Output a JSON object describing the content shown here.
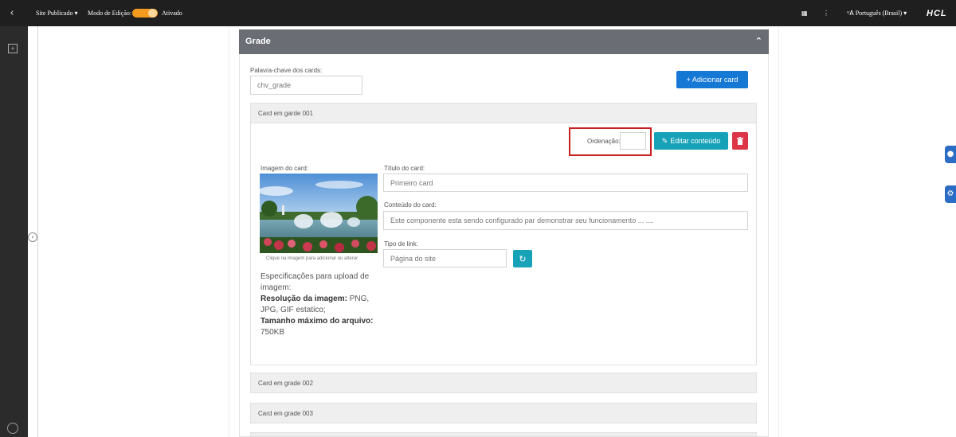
{
  "topbar": {
    "back_icon": "chevron-left-icon",
    "site_label": "Site Publicado",
    "edit_mode_label": "Modo de Edição:",
    "edit_mode_state": "Ativado",
    "language": "Português (Brasil)",
    "brand": "HCL"
  },
  "panel": {
    "title": "Grade",
    "keyword_label": "Palavra-chave dos cards:",
    "keyword_value": "chv_grade",
    "add_card_label": "+ Adicionar card"
  },
  "cards": [
    {
      "header": "Card em garde 001",
      "order_label": "Ordenação:",
      "edit_label": "Editar conteúdo",
      "image_label": "Imagem do card:",
      "image_caption": "Clique na imagem para adicionar ou alterar",
      "title_label": "Título do card:",
      "title_value": "Primeiro card",
      "content_label": "Conteúdo do card:",
      "content_value": "Este componente esta sendo configurado par demonstrar seu funcionamento ... ....",
      "link_type_label": "Tipo de link:",
      "link_type_value": "Página do site",
      "specs": {
        "intro": "Especificações para upload de imagem:",
        "resolution_label": "Resolução da imagem:",
        "resolution_value": "PNG, JPG, GIF estatico;",
        "max_size_label": "Tamanho máximo do arquivo:",
        "max_size_value": "750KB"
      }
    },
    {
      "header": "Card em grade 002"
    },
    {
      "header": "Card em grade 003"
    }
  ],
  "colors": {
    "primary": "#1478d4",
    "teal": "#17a2b8",
    "danger": "#dc3545",
    "toggle": "#f39a1f",
    "panel_header": "#6a6d74",
    "highlight": "#c62020"
  }
}
